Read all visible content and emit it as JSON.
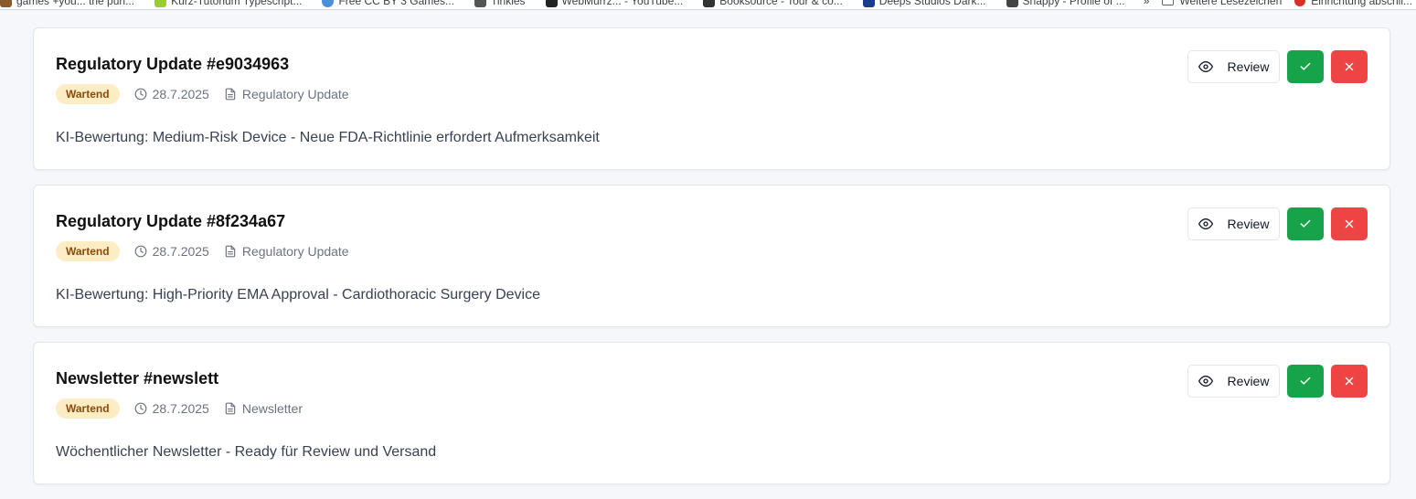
{
  "bookmarks": {
    "items": [
      {
        "label": "games +you... the pun...",
        "color": "#8b5a2b"
      },
      {
        "label": "Kurz-Tutorium Typescript...",
        "color": "#9acd32"
      },
      {
        "label": "Free CC BY 3 Games...",
        "color": "#4a90d9"
      },
      {
        "label": "Tinkles",
        "color": "#555555"
      },
      {
        "label": "WebMurrz... - YouTube...",
        "color": "#222222"
      },
      {
        "label": "Booksource - Tour & co...",
        "color": "#333333"
      },
      {
        "label": "Deeps Studios Dark...",
        "color": "#1a3d8f"
      },
      {
        "label": "Snappy - Profile of ...",
        "color": "#444444"
      }
    ],
    "more_label": "»",
    "folder_label": "Weitere Lesezeichen",
    "right_label": "Einrichtung abschli..."
  },
  "review_label": "Review",
  "cards": [
    {
      "title": "Regulatory Update #e9034963",
      "status": "Wartend",
      "date": "28.7.2025",
      "type": "Regulatory Update",
      "description": "KI-Bewertung: Medium-Risk Device - Neue FDA-Richtlinie erfordert Aufmerksamkeit"
    },
    {
      "title": "Regulatory Update #8f234a67",
      "status": "Wartend",
      "date": "28.7.2025",
      "type": "Regulatory Update",
      "description": "KI-Bewertung: High-Priority EMA Approval - Cardiothoracic Surgery Device"
    },
    {
      "title": "Newsletter #newslett",
      "status": "Wartend",
      "date": "28.7.2025",
      "type": "Newsletter",
      "description": "Wöchentlicher Newsletter - Ready für Review und Versand"
    }
  ],
  "icons": {
    "review": "eye-icon",
    "date": "clock-icon",
    "type": "document-icon",
    "approve": "check-icon",
    "reject": "close-icon"
  },
  "colors": {
    "approve": "#16a34a",
    "reject": "#ef4444",
    "badge_bg": "#fdedc4",
    "badge_text": "#8a4b0a"
  }
}
